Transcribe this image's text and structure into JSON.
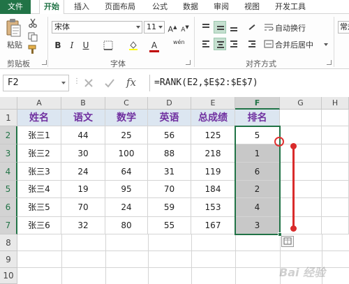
{
  "tabs": [
    {
      "label": "文件",
      "kind": "file"
    },
    {
      "label": "开始",
      "kind": "active"
    },
    {
      "label": "插入"
    },
    {
      "label": "页面布局"
    },
    {
      "label": "公式"
    },
    {
      "label": "数据"
    },
    {
      "label": "审阅"
    },
    {
      "label": "视图"
    },
    {
      "label": "开发工具"
    }
  ],
  "ribbon": {
    "clipboard_label": "剪贴板",
    "paste_label": "粘贴",
    "font_group_label": "字体",
    "font_name": "宋体",
    "font_size": "11",
    "align_group_label": "对齐方式",
    "wrap_text": "自动换行",
    "merge_center": "合并后居中",
    "number_format": "常规",
    "wen_label": "wén"
  },
  "formula_bar": {
    "name_box": "F2",
    "formula": "=RANK(E2,$E$2:$E$7)"
  },
  "grid": {
    "columns": [
      "A",
      "B",
      "C",
      "D",
      "E",
      "F",
      "G",
      "H"
    ],
    "selected_column": "F",
    "rows": [
      "1",
      "2",
      "3",
      "4",
      "5",
      "6",
      "7",
      "8",
      "9",
      "10"
    ],
    "header": [
      "姓名",
      "语文",
      "数学",
      "英语",
      "总成绩",
      "排名"
    ],
    "data": [
      [
        "张三1",
        "44",
        "25",
        "56",
        "125",
        "5"
      ],
      [
        "张三2",
        "30",
        "100",
        "88",
        "218",
        "1"
      ],
      [
        "张三3",
        "24",
        "64",
        "31",
        "119",
        "6"
      ],
      [
        "张三4",
        "19",
        "95",
        "70",
        "184",
        "2"
      ],
      [
        "张三5",
        "70",
        "24",
        "59",
        "153",
        "4"
      ],
      [
        "张三6",
        "32",
        "80",
        "55",
        "167",
        "3"
      ]
    ]
  },
  "colors": {
    "accent": "#217346",
    "header_fill": "#dce6f1",
    "header_text": "#7030a0",
    "selection_fill": "#c8c8c8",
    "annotation": "#d92b2b"
  },
  "watermark": "Bai 经验"
}
